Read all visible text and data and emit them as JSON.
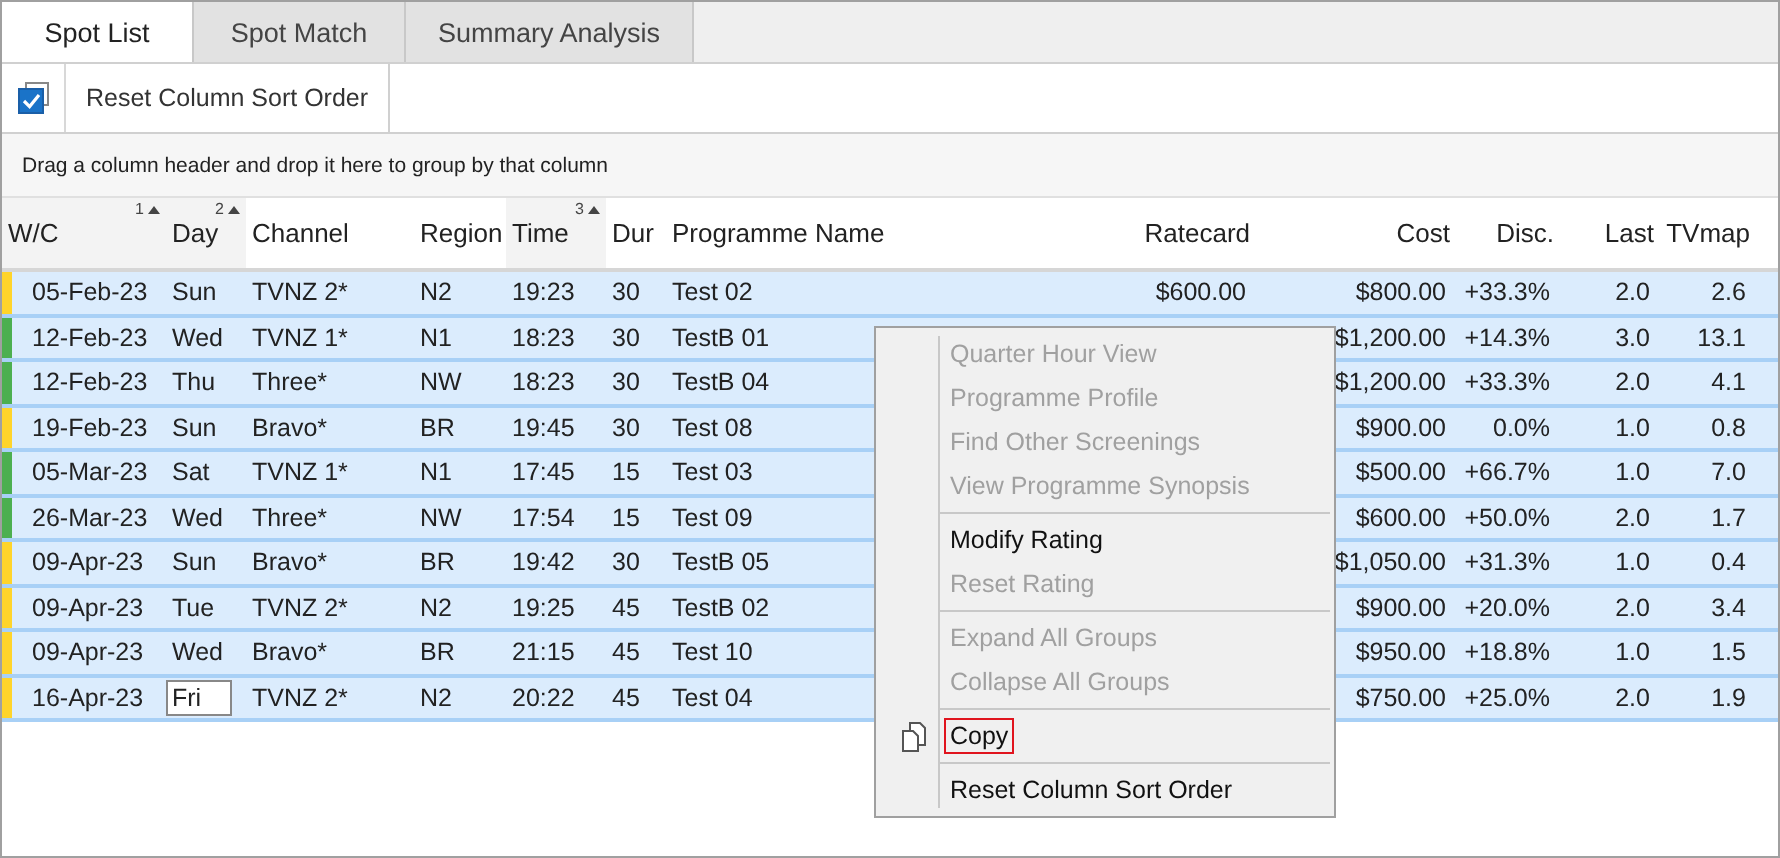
{
  "tabs": [
    {
      "label": "Spot List",
      "selected": true
    },
    {
      "label": "Spot Match",
      "selected": false
    },
    {
      "label": "Summary Analysis",
      "selected": false
    }
  ],
  "toolbar": {
    "select_all": {
      "checked": true
    },
    "reset_button": "Reset Column Sort Order"
  },
  "group_panel": {
    "hint": "Drag a column header and drop it here to group by that column"
  },
  "table": {
    "columns": [
      {
        "label": "W/C",
        "sort": "1",
        "sorted": true
      },
      {
        "label": "Day",
        "sort": "2",
        "sorted": true
      },
      {
        "label": "Channel",
        "sorted": false
      },
      {
        "label": "Region",
        "sorted": false
      },
      {
        "label": "Time",
        "sort": "3",
        "sorted": true
      },
      {
        "label": "Dur",
        "sorted": false
      },
      {
        "label": "Programme Name",
        "sorted": false
      },
      {
        "label": "Ratecard",
        "sorted": false
      },
      {
        "label": "Cost",
        "sorted": false
      },
      {
        "label": "Disc.",
        "sorted": false
      },
      {
        "label": "Last",
        "sorted": false
      },
      {
        "label": "TVmap",
        "sorted": false
      }
    ],
    "rows": [
      {
        "color": "#ffd42a",
        "wc": "05-Feb-23",
        "day": "Sun",
        "channel": "TVNZ 2*",
        "region": "N2",
        "time": "19:23",
        "dur": "30",
        "programme": "Test 02",
        "ratecard": "$600.00",
        "cost": "$800.00",
        "disc": "+33.3%",
        "last": "2.0",
        "tvmap": "2.6"
      },
      {
        "color": "#4caf50",
        "wc": "12-Feb-23",
        "day": "Wed",
        "channel": "TVNZ 1*",
        "region": "N1",
        "time": "18:23",
        "dur": "30",
        "programme": "TestB 01",
        "cost": "$1,200.00",
        "disc": "+14.3%",
        "last": "3.0",
        "tvmap": "13.1"
      },
      {
        "color": "#4caf50",
        "wc": "12-Feb-23",
        "day": "Thu",
        "channel": "Three*",
        "region": "NW",
        "time": "18:23",
        "dur": "30",
        "programme": "TestB 04",
        "cost": "$1,200.00",
        "disc": "+33.3%",
        "last": "2.0",
        "tvmap": "4.1"
      },
      {
        "color": "#ffd42a",
        "wc": "19-Feb-23",
        "day": "Sun",
        "channel": "Bravo*",
        "region": "BR",
        "time": "19:45",
        "dur": "30",
        "programme": "Test 08",
        "cost": "$900.00",
        "disc": "0.0%",
        "last": "1.0",
        "tvmap": "0.8"
      },
      {
        "color": "#4caf50",
        "wc": "05-Mar-23",
        "day": "Sat",
        "channel": "TVNZ 1*",
        "region": "N1",
        "time": "17:45",
        "dur": "15",
        "programme": "Test 03",
        "cost": "$500.00",
        "disc": "+66.7%",
        "last": "1.0",
        "tvmap": "7.0"
      },
      {
        "color": "#4caf50",
        "wc": "26-Mar-23",
        "day": "Wed",
        "channel": "Three*",
        "region": "NW",
        "time": "17:54",
        "dur": "15",
        "programme": "Test 09",
        "cost": "$600.00",
        "disc": "+50.0%",
        "last": "2.0",
        "tvmap": "1.7"
      },
      {
        "color": "#ffd42a",
        "wc": "09-Apr-23",
        "day": "Sun",
        "channel": "Bravo*",
        "region": "BR",
        "time": "19:42",
        "dur": "30",
        "programme": "TestB 05",
        "cost": "$1,050.00",
        "disc": "+31.3%",
        "last": "1.0",
        "tvmap": "0.4"
      },
      {
        "color": "#ffd42a",
        "wc": "09-Apr-23",
        "day": "Tue",
        "channel": "TVNZ 2*",
        "region": "N2",
        "time": "19:25",
        "dur": "45",
        "programme": "TestB 02",
        "cost": "$900.00",
        "disc": "+20.0%",
        "last": "2.0",
        "tvmap": "3.4"
      },
      {
        "color": "#ffd42a",
        "wc": "09-Apr-23",
        "day": "Wed",
        "channel": "Bravo*",
        "region": "BR",
        "time": "21:15",
        "dur": "45",
        "programme": "Test 10",
        "cost": "$950.00",
        "disc": "+18.8%",
        "last": "1.0",
        "tvmap": "1.5"
      },
      {
        "color": "#ffd42a",
        "wc": "16-Apr-23",
        "day": {
          "text": "Fri",
          "focused": true
        },
        "channel": "TVNZ 2*",
        "region": "N2",
        "time": "20:22",
        "dur": "45",
        "programme": "Test 04",
        "cost": "$750.00",
        "disc": "+25.0%",
        "last": "2.0",
        "tvmap": "1.9"
      }
    ]
  },
  "context_menu": {
    "items": [
      {
        "kind": "item",
        "label": "Quarter Hour View",
        "disabled": true,
        "selected": false
      },
      {
        "kind": "item",
        "label": "Programme Profile",
        "disabled": true,
        "selected": false
      },
      {
        "kind": "item",
        "label": "Find Other Screenings",
        "disabled": true,
        "selected": false
      },
      {
        "kind": "item",
        "label": "View Programme Synopsis",
        "disabled": true,
        "selected": false
      },
      {
        "kind": "separator"
      },
      {
        "kind": "item",
        "label": "Modify Rating",
        "disabled": false,
        "selected": false
      },
      {
        "kind": "item",
        "label": "Reset Rating",
        "disabled": true,
        "selected": false
      },
      {
        "kind": "separator"
      },
      {
        "kind": "item",
        "label": "Expand All Groups",
        "disabled": true,
        "selected": false
      },
      {
        "kind": "item",
        "label": "Collapse All Groups",
        "disabled": true,
        "selected": false
      },
      {
        "kind": "separator"
      },
      {
        "kind": "copy",
        "label": "Copy",
        "disabled": false,
        "selected": true
      },
      {
        "kind": "separator"
      },
      {
        "kind": "item",
        "label": "Reset Column Sort Order",
        "disabled": false,
        "selected": false
      }
    ]
  }
}
